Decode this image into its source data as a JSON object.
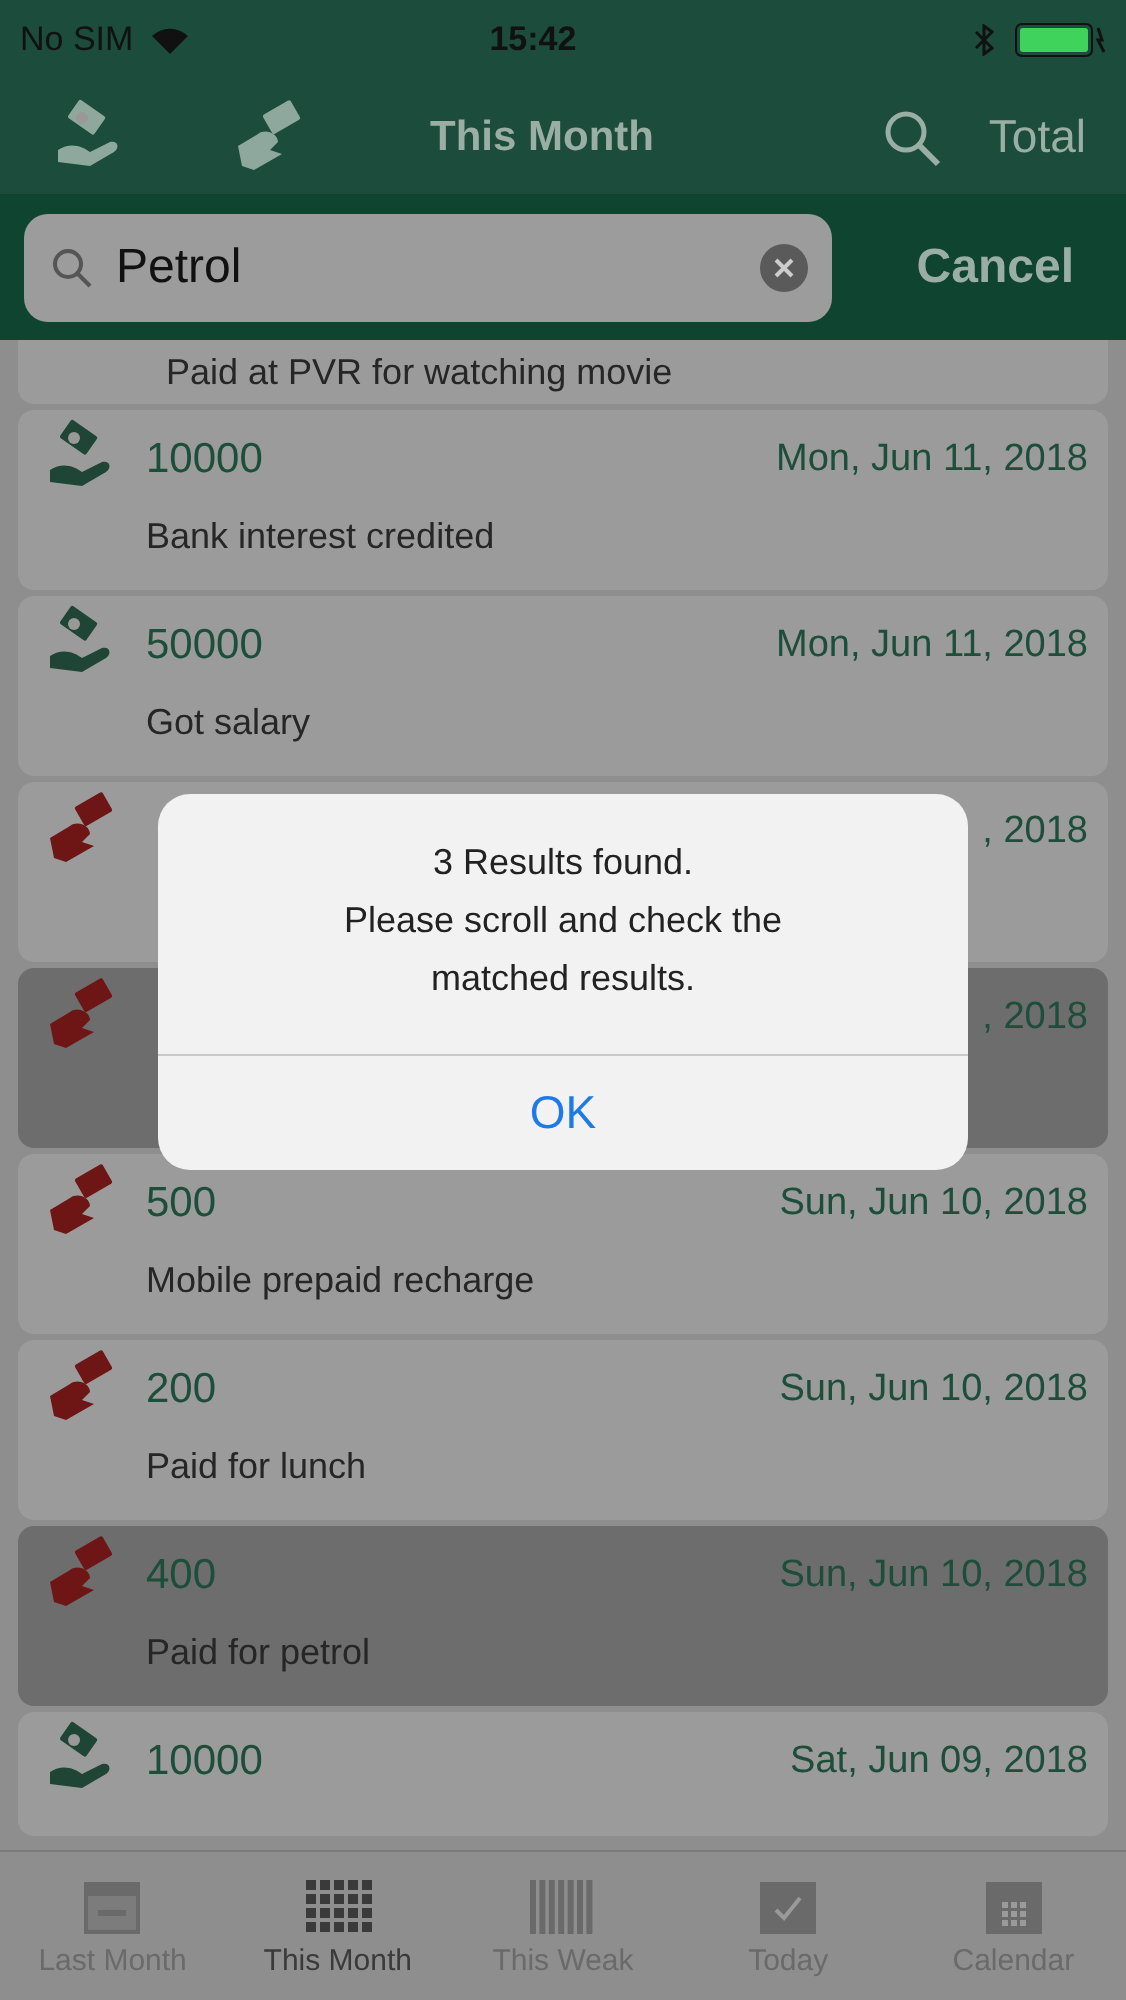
{
  "status_bar": {
    "carrier": "No SIM",
    "time": "15:42"
  },
  "nav_bar": {
    "title": "This Month",
    "total": "Total"
  },
  "search": {
    "value": "Petrol",
    "cancel": "Cancel"
  },
  "rows": [
    {
      "kind": "partial",
      "matched": false,
      "description": "Paid at PVR for watching movie"
    },
    {
      "kind": "income",
      "matched": false,
      "amount": "10000",
      "date": "Mon, Jun 11, 2018",
      "description": "Bank interest credited"
    },
    {
      "kind": "income",
      "matched": false,
      "amount": "50000",
      "date": "Mon, Jun 11, 2018",
      "description": "Got salary"
    },
    {
      "kind": "expense",
      "matched": false,
      "date": ", 2018"
    },
    {
      "kind": "expense",
      "matched": true,
      "date": ", 2018"
    },
    {
      "kind": "expense",
      "matched": false,
      "amount": "500",
      "date": "Sun, Jun 10, 2018",
      "description": "Mobile prepaid recharge"
    },
    {
      "kind": "expense",
      "matched": false,
      "amount": "200",
      "date": "Sun, Jun 10, 2018",
      "description": "Paid for lunch"
    },
    {
      "kind": "expense",
      "matched": true,
      "amount": "400",
      "date": "Sun, Jun 10, 2018",
      "description": "Paid for petrol"
    },
    {
      "kind": "income",
      "matched": false,
      "amount": "10000",
      "date": "Sat, Jun 09, 2018"
    }
  ],
  "alert": {
    "message": [
      "3 Results found.",
      "Please scroll and check the",
      "matched results."
    ],
    "button": "OK"
  },
  "tabs": [
    {
      "label": "Last Month",
      "kind": "last",
      "selected": false
    },
    {
      "label": "This Month",
      "kind": "month",
      "selected": true
    },
    {
      "label": "This Weak",
      "kind": "week",
      "selected": false
    },
    {
      "label": "Today",
      "kind": "today",
      "selected": false
    },
    {
      "label": "Calendar",
      "kind": "calendar",
      "selected": false
    }
  ]
}
